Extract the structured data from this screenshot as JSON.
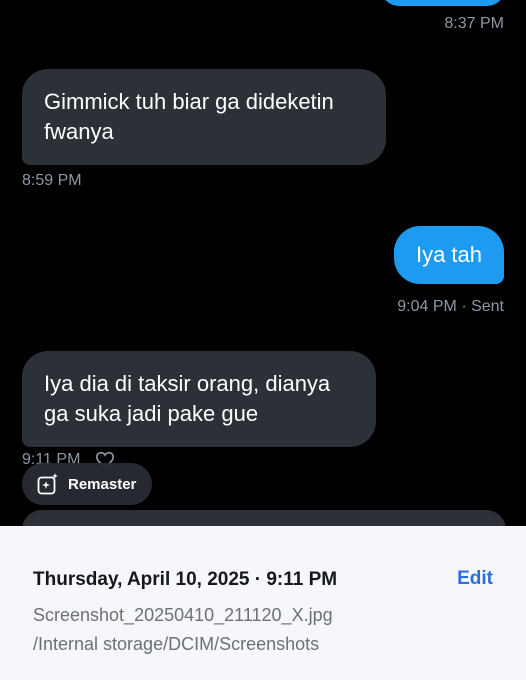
{
  "chat": {
    "top_timestamp": "8:37 PM",
    "messages": [
      {
        "direction": "received",
        "text": "Gimmick tuh biar ga dideketin fwanya",
        "time": "8:59 PM"
      },
      {
        "direction": "sent",
        "text": "Iya tah",
        "time": "9:04 PM · Sent"
      },
      {
        "direction": "received",
        "text": "Iya dia di taksir orang, dianya ga suka jadi pake gue",
        "time": "9:11 PM"
      }
    ],
    "colors": {
      "received_bubble": "#2c3138",
      "sent_bubble": "#1d9bf0",
      "timestamp": "#8b98a5"
    }
  },
  "remaster": {
    "label": "Remaster",
    "icon": "sparkle-image-icon"
  },
  "details": {
    "date_time": "Thursday, April 10, 2025 · 9:11 PM",
    "edit_label": "Edit",
    "filename": "Screenshot_20250410_211120_X.jpg",
    "path": "/Internal storage/DCIM/Screenshots"
  }
}
